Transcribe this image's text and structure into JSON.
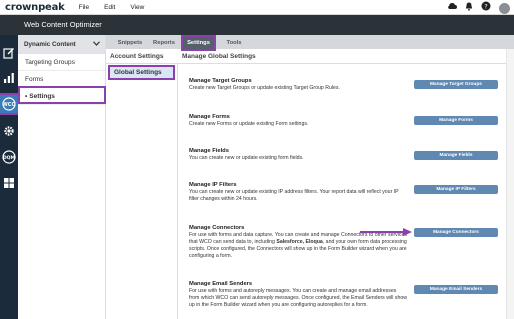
{
  "app": {
    "logo_main": "crownpeak",
    "title": "Web Content Optimizer"
  },
  "menu": {
    "file": "File",
    "edit": "Edit",
    "view": "View"
  },
  "top_icons": [
    "cloud-icon",
    "bell-icon",
    "help-icon",
    "avatar"
  ],
  "rail_icons": [
    "edit-icon",
    "chart-icon",
    "wco-icon",
    "gear-icon",
    "dqm-icon",
    "apps-icon"
  ],
  "nav": {
    "header": "Dynamic Content",
    "items": [
      {
        "label": "Targeting Groups"
      },
      {
        "label": "Forms"
      },
      {
        "label": "Settings",
        "prefix": "•"
      }
    ]
  },
  "tabs": [
    "Snippets",
    "Reports",
    "Settings",
    "Tools"
  ],
  "account_settings": {
    "header": "Account Settings",
    "item": "Global Settings"
  },
  "manage": {
    "header": "Manage Global Settings",
    "rows": [
      {
        "title": "Manage Target Groups",
        "desc": "Create new Target Groups or update existing Target Group Rules.",
        "button": "Manage Target Groups"
      },
      {
        "title": "Manage Forms",
        "desc": "Create new Forms or update existing Form settings.",
        "button": "Manage Forms"
      },
      {
        "title": "Manage Fields",
        "desc": "You can create new or update existing form fields.",
        "button": "Manage Fields"
      },
      {
        "title": "Manage IP Filters",
        "desc": "You can create new or update existing IP address filters. Your report data will reflect your IP filter changes within 24 hours.",
        "button": "Manage IP Filters"
      },
      {
        "title": "Manage Connectors",
        "desc_a": "For use with forms and data capture. You can create and manage Connectors to other services that WCO can send data to, including ",
        "desc_b": "Salesforce, Eloqua",
        "desc_c": ", and your own form data processing scripts. Once configured, the Connectors will show up in the Form Builder wizard when you are configuring a form.",
        "button": "Manage Connectors"
      },
      {
        "title": "Manage Email Senders",
        "desc": "For use with forms and autoreply messages. You can create and manage email addresses from which WCO can send autoreply messages. Once configured, the Email Senders will show up in the Form Builder wizard when you are configuring autoreplies for a form.",
        "button": "Manage Email Senders"
      }
    ]
  },
  "colors": {
    "highlight": "#8e3fae",
    "button": "#5f88b3",
    "rail": "#1b2b3c",
    "titlebar": "#2b3238"
  }
}
